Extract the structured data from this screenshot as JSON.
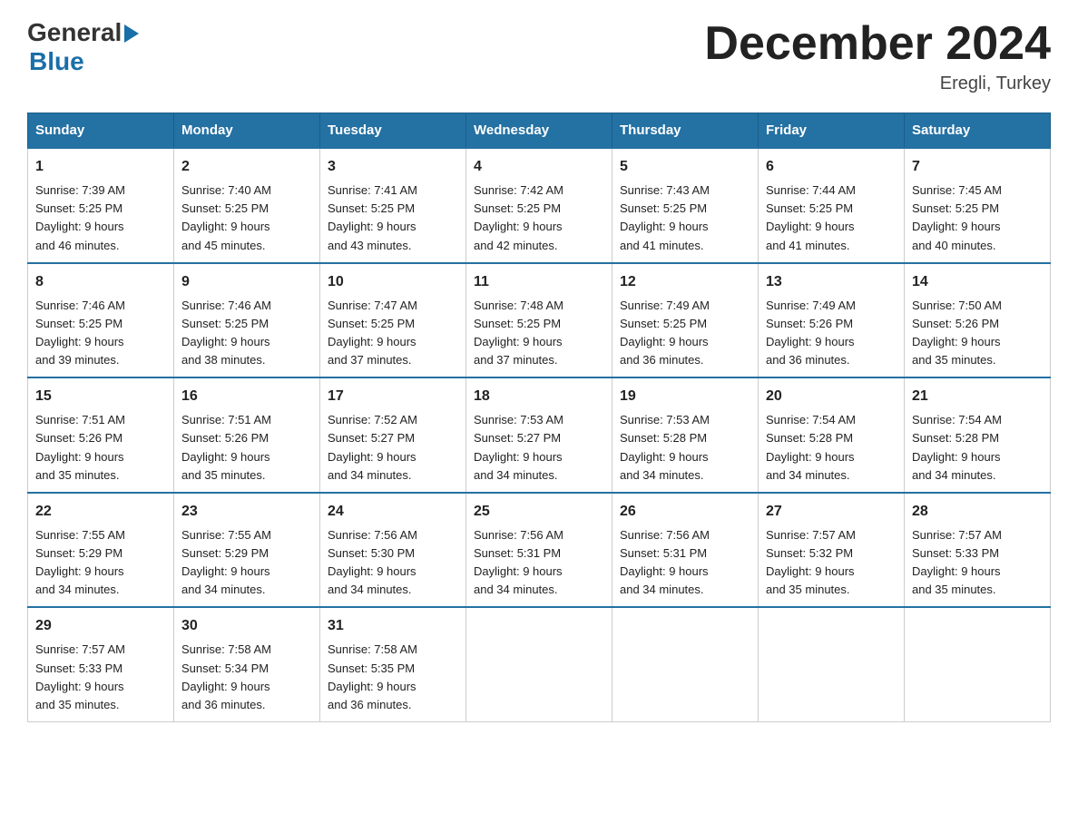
{
  "header": {
    "logo_general": "General",
    "logo_blue": "Blue",
    "month_title": "December 2024",
    "location": "Eregli, Turkey"
  },
  "weekdays": [
    "Sunday",
    "Monday",
    "Tuesday",
    "Wednesday",
    "Thursday",
    "Friday",
    "Saturday"
  ],
  "weeks": [
    [
      {
        "day": "1",
        "sunrise": "7:39 AM",
        "sunset": "5:25 PM",
        "daylight": "9 hours and 46 minutes."
      },
      {
        "day": "2",
        "sunrise": "7:40 AM",
        "sunset": "5:25 PM",
        "daylight": "9 hours and 45 minutes."
      },
      {
        "day": "3",
        "sunrise": "7:41 AM",
        "sunset": "5:25 PM",
        "daylight": "9 hours and 43 minutes."
      },
      {
        "day": "4",
        "sunrise": "7:42 AM",
        "sunset": "5:25 PM",
        "daylight": "9 hours and 42 minutes."
      },
      {
        "day": "5",
        "sunrise": "7:43 AM",
        "sunset": "5:25 PM",
        "daylight": "9 hours and 41 minutes."
      },
      {
        "day": "6",
        "sunrise": "7:44 AM",
        "sunset": "5:25 PM",
        "daylight": "9 hours and 41 minutes."
      },
      {
        "day": "7",
        "sunrise": "7:45 AM",
        "sunset": "5:25 PM",
        "daylight": "9 hours and 40 minutes."
      }
    ],
    [
      {
        "day": "8",
        "sunrise": "7:46 AM",
        "sunset": "5:25 PM",
        "daylight": "9 hours and 39 minutes."
      },
      {
        "day": "9",
        "sunrise": "7:46 AM",
        "sunset": "5:25 PM",
        "daylight": "9 hours and 38 minutes."
      },
      {
        "day": "10",
        "sunrise": "7:47 AM",
        "sunset": "5:25 PM",
        "daylight": "9 hours and 37 minutes."
      },
      {
        "day": "11",
        "sunrise": "7:48 AM",
        "sunset": "5:25 PM",
        "daylight": "9 hours and 37 minutes."
      },
      {
        "day": "12",
        "sunrise": "7:49 AM",
        "sunset": "5:25 PM",
        "daylight": "9 hours and 36 minutes."
      },
      {
        "day": "13",
        "sunrise": "7:49 AM",
        "sunset": "5:26 PM",
        "daylight": "9 hours and 36 minutes."
      },
      {
        "day": "14",
        "sunrise": "7:50 AM",
        "sunset": "5:26 PM",
        "daylight": "9 hours and 35 minutes."
      }
    ],
    [
      {
        "day": "15",
        "sunrise": "7:51 AM",
        "sunset": "5:26 PM",
        "daylight": "9 hours and 35 minutes."
      },
      {
        "day": "16",
        "sunrise": "7:51 AM",
        "sunset": "5:26 PM",
        "daylight": "9 hours and 35 minutes."
      },
      {
        "day": "17",
        "sunrise": "7:52 AM",
        "sunset": "5:27 PM",
        "daylight": "9 hours and 34 minutes."
      },
      {
        "day": "18",
        "sunrise": "7:53 AM",
        "sunset": "5:27 PM",
        "daylight": "9 hours and 34 minutes."
      },
      {
        "day": "19",
        "sunrise": "7:53 AM",
        "sunset": "5:28 PM",
        "daylight": "9 hours and 34 minutes."
      },
      {
        "day": "20",
        "sunrise": "7:54 AM",
        "sunset": "5:28 PM",
        "daylight": "9 hours and 34 minutes."
      },
      {
        "day": "21",
        "sunrise": "7:54 AM",
        "sunset": "5:28 PM",
        "daylight": "9 hours and 34 minutes."
      }
    ],
    [
      {
        "day": "22",
        "sunrise": "7:55 AM",
        "sunset": "5:29 PM",
        "daylight": "9 hours and 34 minutes."
      },
      {
        "day": "23",
        "sunrise": "7:55 AM",
        "sunset": "5:29 PM",
        "daylight": "9 hours and 34 minutes."
      },
      {
        "day": "24",
        "sunrise": "7:56 AM",
        "sunset": "5:30 PM",
        "daylight": "9 hours and 34 minutes."
      },
      {
        "day": "25",
        "sunrise": "7:56 AM",
        "sunset": "5:31 PM",
        "daylight": "9 hours and 34 minutes."
      },
      {
        "day": "26",
        "sunrise": "7:56 AM",
        "sunset": "5:31 PM",
        "daylight": "9 hours and 34 minutes."
      },
      {
        "day": "27",
        "sunrise": "7:57 AM",
        "sunset": "5:32 PM",
        "daylight": "9 hours and 35 minutes."
      },
      {
        "day": "28",
        "sunrise": "7:57 AM",
        "sunset": "5:33 PM",
        "daylight": "9 hours and 35 minutes."
      }
    ],
    [
      {
        "day": "29",
        "sunrise": "7:57 AM",
        "sunset": "5:33 PM",
        "daylight": "9 hours and 35 minutes."
      },
      {
        "day": "30",
        "sunrise": "7:58 AM",
        "sunset": "5:34 PM",
        "daylight": "9 hours and 36 minutes."
      },
      {
        "day": "31",
        "sunrise": "7:58 AM",
        "sunset": "5:35 PM",
        "daylight": "9 hours and 36 minutes."
      },
      null,
      null,
      null,
      null
    ]
  ],
  "labels": {
    "sunrise": "Sunrise:",
    "sunset": "Sunset:",
    "daylight": "Daylight:"
  }
}
